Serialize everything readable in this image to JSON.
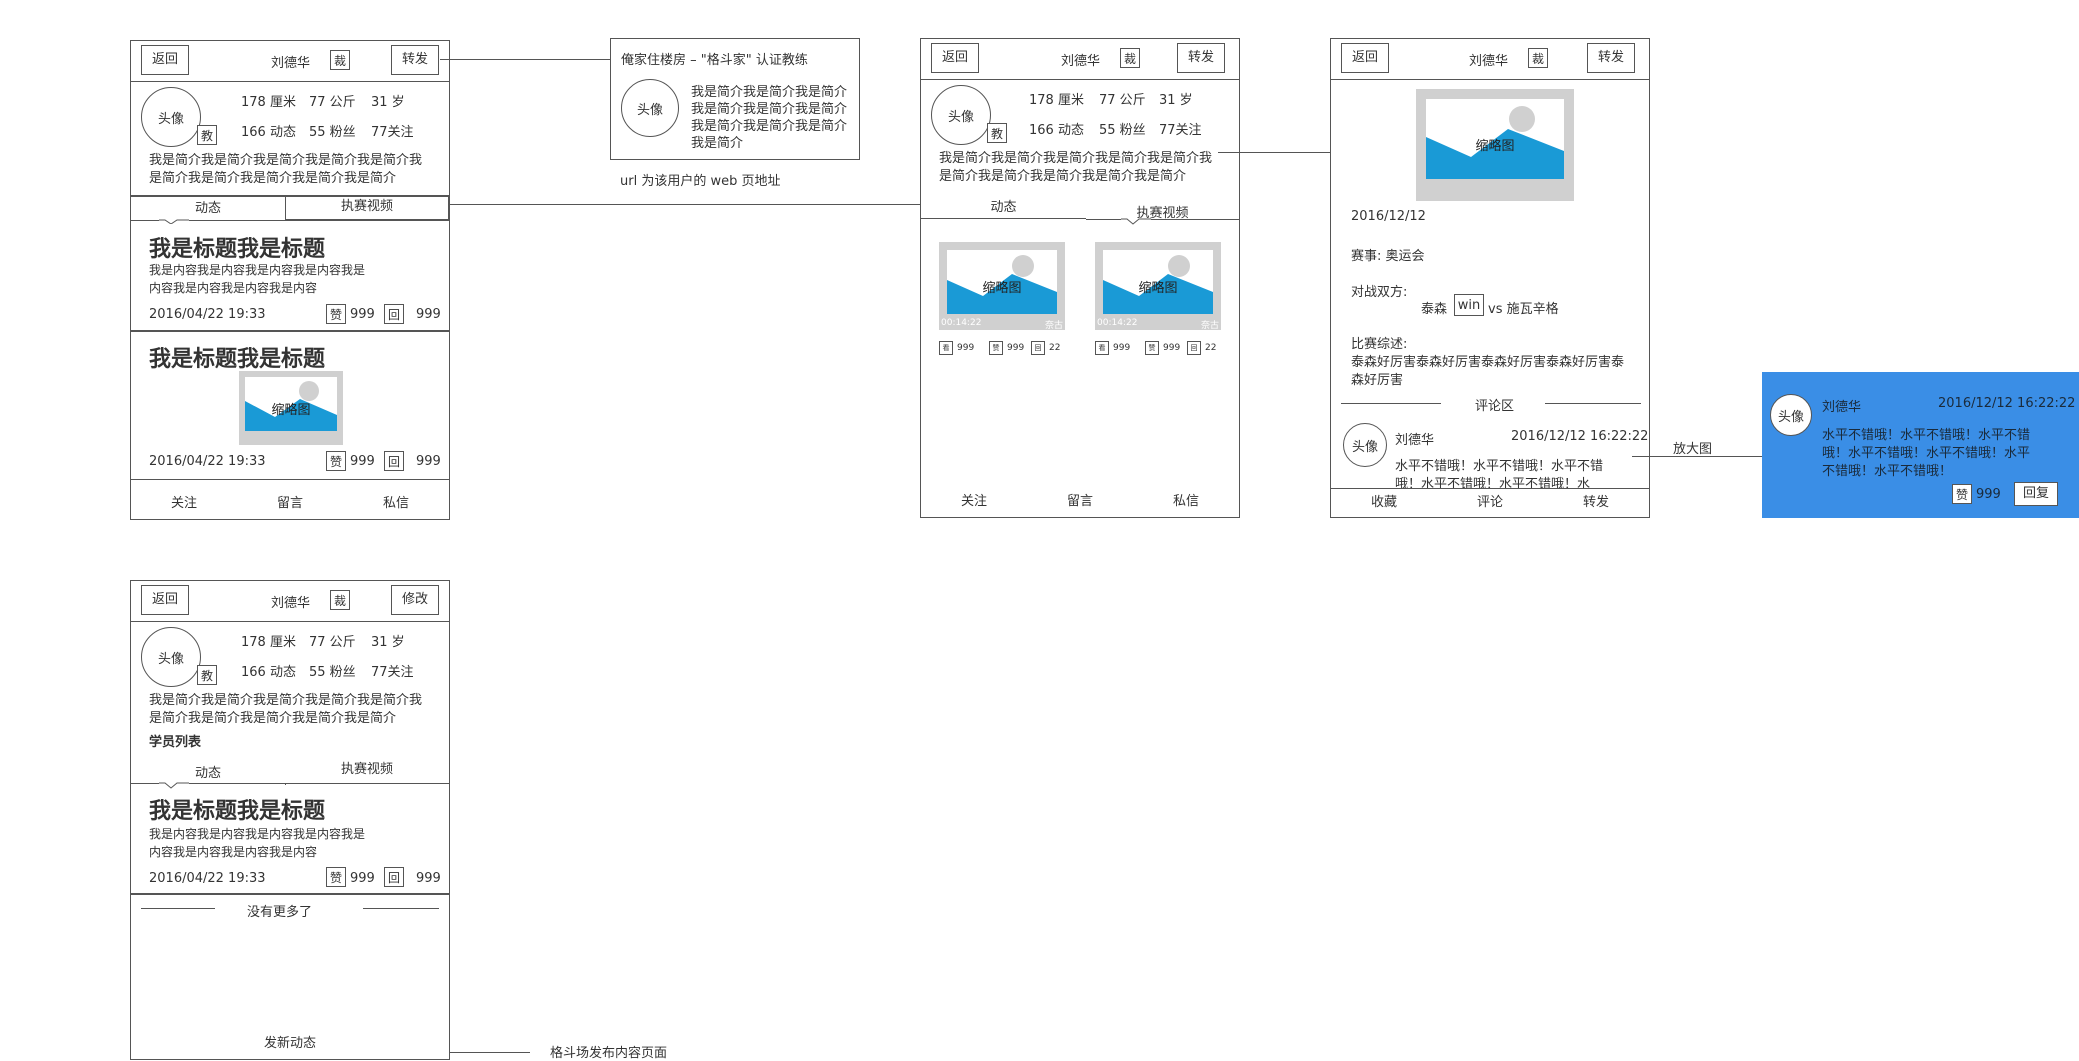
{
  "common": {
    "back": "返回",
    "name": "刘德华",
    "cert_badge": "裁",
    "share": "转发",
    "edit": "修改",
    "avatar": "头像",
    "coach_badge": "教",
    "height": "178 厘米",
    "weight": "77 公斤",
    "age": "31 岁",
    "posts": "166 动态",
    "fans": "55 粉丝",
    "follows": "77关注",
    "bio_line1": "我是简介我是简介我是简介我是简介我是简介我",
    "bio_line2": "是简介我是简介我是简介我是简介我是简介",
    "bio_line1b": "我是简介我是简介我是简介我是简介我是简介我",
    "tab_posts": "动态",
    "tab_videos": "执赛视频",
    "post_title": "我是标题我是标题",
    "post_content1": "我是内容我是内容我是内容我是内容我是",
    "post_content2": "内容我是内容我是内容我是内容",
    "post_time": "2016/04/22 19:33",
    "like": "赞",
    "reply": "回",
    "count": "999",
    "thumb_label": "缩略图",
    "follow": "关注",
    "message": "留言",
    "dm": "私信"
  },
  "popup": {
    "header": "俺家住楼房 – \"格斗家\" 认证教练",
    "avatar": "头像",
    "bio": "我是简介我是简介我是简介我是简介我是简介我是简介我是简介我是简介我是简介我是简介我是简介",
    "bio1": "我是简介我是简介我是简介",
    "bio2": "我是简介我是简介我是简介",
    "bio3": "我是简介我是简介我是简介",
    "bio4": "我是简介",
    "note": "url 为该用户的 web 页地址"
  },
  "screen2": {
    "video_time": "00:14:22",
    "video_views_tag": "看",
    "video_views": "999",
    "like_tag": "赞",
    "likes": "999",
    "comment_tag": "回",
    "comments": "22",
    "tiny_tag": "奈古"
  },
  "screen3": {
    "collect": "收藏",
    "comment": "评论",
    "share": "转发",
    "date": "2016/12/12",
    "event": "赛事: 奥运会",
    "sides_label": "对战双方:",
    "side_a": "泰森",
    "win": "win",
    "vs": "vs 施瓦辛格",
    "summary_label": "比赛综述:",
    "summary1": "泰森好厉害泰森好厉害泰森好厉害泰森好厉害泰",
    "summary2": "森好厉害",
    "comment_area": "评论区",
    "commenter": "刘德华",
    "comment_time": "2016/12/12 16:22:22",
    "comment1": "水平不错哦！水平不错哦！水平不错",
    "comment2": "哦！水平不错哦！水平不错哦！水"
  },
  "enlarge": {
    "label": "放大图",
    "avatar": "头像",
    "name": "刘德华",
    "time": "2016/12/12 16:22:22",
    "line1": "水平不错哦！水平不错哦！水平不错",
    "line2": "哦！水平不错哦！水平不错哦！水平",
    "line3": "不错哦！水平不错哦！",
    "like": "赞",
    "likes": "999",
    "reply": "回复"
  },
  "screen4": {
    "students": "学员列表",
    "no_more": "没有更多了",
    "publish": "发新动态",
    "publish_note": "格斗场发布内容页面"
  },
  "colors": {
    "accent": "#3a8ee6",
    "image_blue": "#1a9ad6",
    "thumb_gray": "#d0d0d0"
  }
}
